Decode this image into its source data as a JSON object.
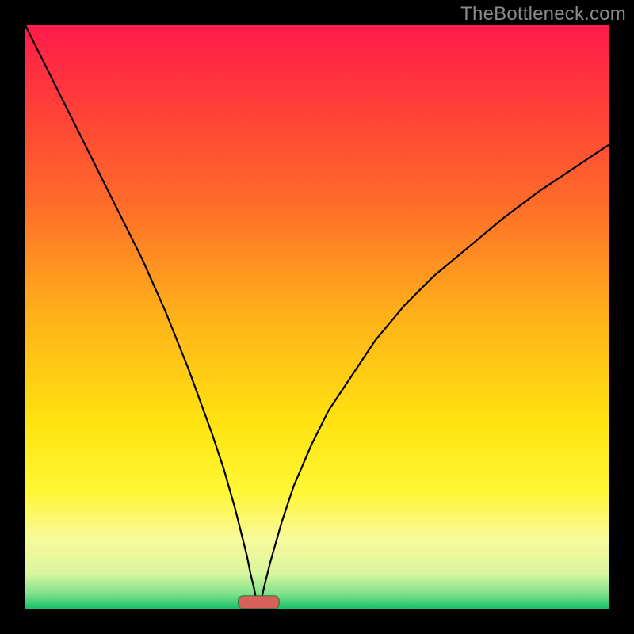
{
  "watermark": "TheBottleneck.com",
  "colors": {
    "frame": "#000000",
    "gradient_stops": [
      {
        "offset": 0.0,
        "color": "#ff1b4b"
      },
      {
        "offset": 0.12,
        "color": "#ff3a3b"
      },
      {
        "offset": 0.3,
        "color": "#ff6a2a"
      },
      {
        "offset": 0.5,
        "color": "#ffb21a"
      },
      {
        "offset": 0.68,
        "color": "#ffe310"
      },
      {
        "offset": 0.8,
        "color": "#fff735"
      },
      {
        "offset": 0.88,
        "color": "#f8fa9a"
      },
      {
        "offset": 0.94,
        "color": "#d9f6a0"
      },
      {
        "offset": 0.975,
        "color": "#7ee08a"
      },
      {
        "offset": 1.0,
        "color": "#19c06a"
      }
    ],
    "curve": "#000000",
    "marker_fill": "#d9605a",
    "marker_stroke": "#317a39"
  },
  "chart_data": {
    "type": "line",
    "title": "",
    "xlabel": "",
    "ylabel": "",
    "xlim": [
      0,
      100
    ],
    "ylim": [
      0,
      100
    ],
    "legend": null,
    "grid": false,
    "annotations": [],
    "optimum_x": 40,
    "marker": {
      "x_center": 40,
      "x_halfwidth": 3.5,
      "y": 0,
      "height": 2.2
    },
    "series": [
      {
        "name": "left-branch",
        "x": [
          0,
          4,
          8,
          12,
          16,
          20,
          24,
          28,
          32,
          34,
          36,
          37,
          38,
          38.6,
          39.2,
          39.6,
          40
        ],
        "y": [
          100,
          92,
          84,
          76,
          68,
          60,
          51,
          41,
          30,
          24,
          17,
          13,
          9,
          6,
          3.5,
          1.5,
          0
        ]
      },
      {
        "name": "right-branch",
        "x": [
          40,
          40.5,
          41,
          42,
          43,
          44,
          46,
          49,
          52,
          56,
          60,
          65,
          70,
          76,
          82,
          88,
          94,
          100
        ],
        "y": [
          0,
          1.8,
          4,
          8,
          11.5,
          15,
          21,
          28,
          34,
          40,
          46,
          52,
          57,
          62,
          67,
          71.5,
          75.5,
          79.5
        ]
      }
    ]
  }
}
